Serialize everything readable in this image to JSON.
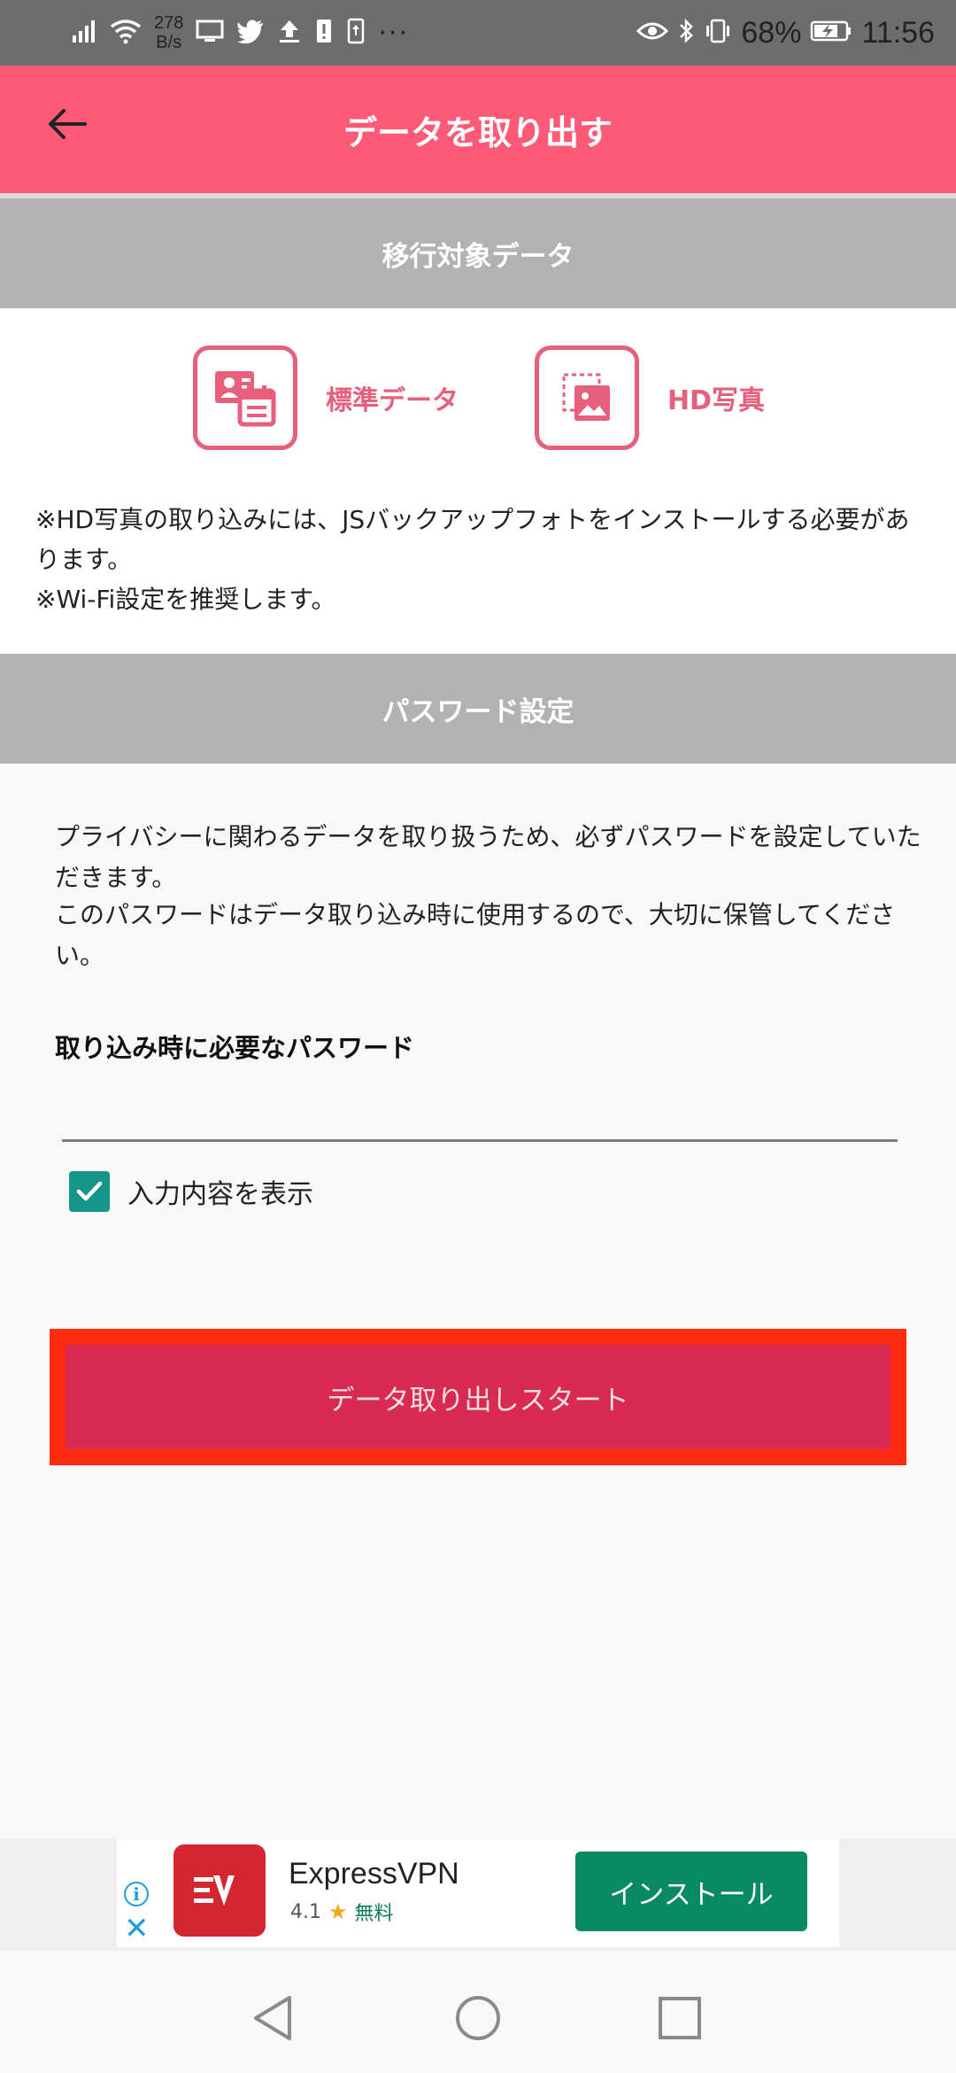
{
  "status_bar": {
    "net_speed_value": "278",
    "net_speed_unit": "B/s",
    "overflow": "···",
    "battery": "68%",
    "time": "11:56"
  },
  "header": {
    "title": "データを取り出す"
  },
  "sections": {
    "target_data_title": "移行対象データ",
    "password_title": "パスワード設定"
  },
  "target_data": {
    "items": [
      {
        "label": "標準データ",
        "icon": "standard-data-icon"
      },
      {
        "label": "HD写真",
        "icon": "hd-photo-icon"
      }
    ],
    "notes": [
      "※HD写真の取り込みには、JSバックアップフォトをインストールする必要があります。",
      "※Wi-Fi設定を推奨します。"
    ]
  },
  "password": {
    "description": [
      "プライバシーに関わるデータを取り扱うため、必ずパスワードを設定していただきます。",
      "このパスワードはデータ取り込み時に使用するので、大切に保管してください。"
    ],
    "field_label": "取り込み時に必要なパスワード",
    "field_value": "",
    "show_input_label": "入力内容を表示",
    "show_input_checked": true
  },
  "actions": {
    "start_label": "データ取り出しスタート"
  },
  "ad": {
    "app_name": "ExpressVPN",
    "rating": "4.1",
    "price": "無料",
    "install_label": "インストール"
  },
  "colors": {
    "app_bar": "#fd5a78",
    "accent_pink": "#e6607b",
    "start_button": "#d92b52",
    "highlight_outline": "#ff2a12",
    "checkbox": "#169688",
    "install_button": "#0a8a63"
  }
}
